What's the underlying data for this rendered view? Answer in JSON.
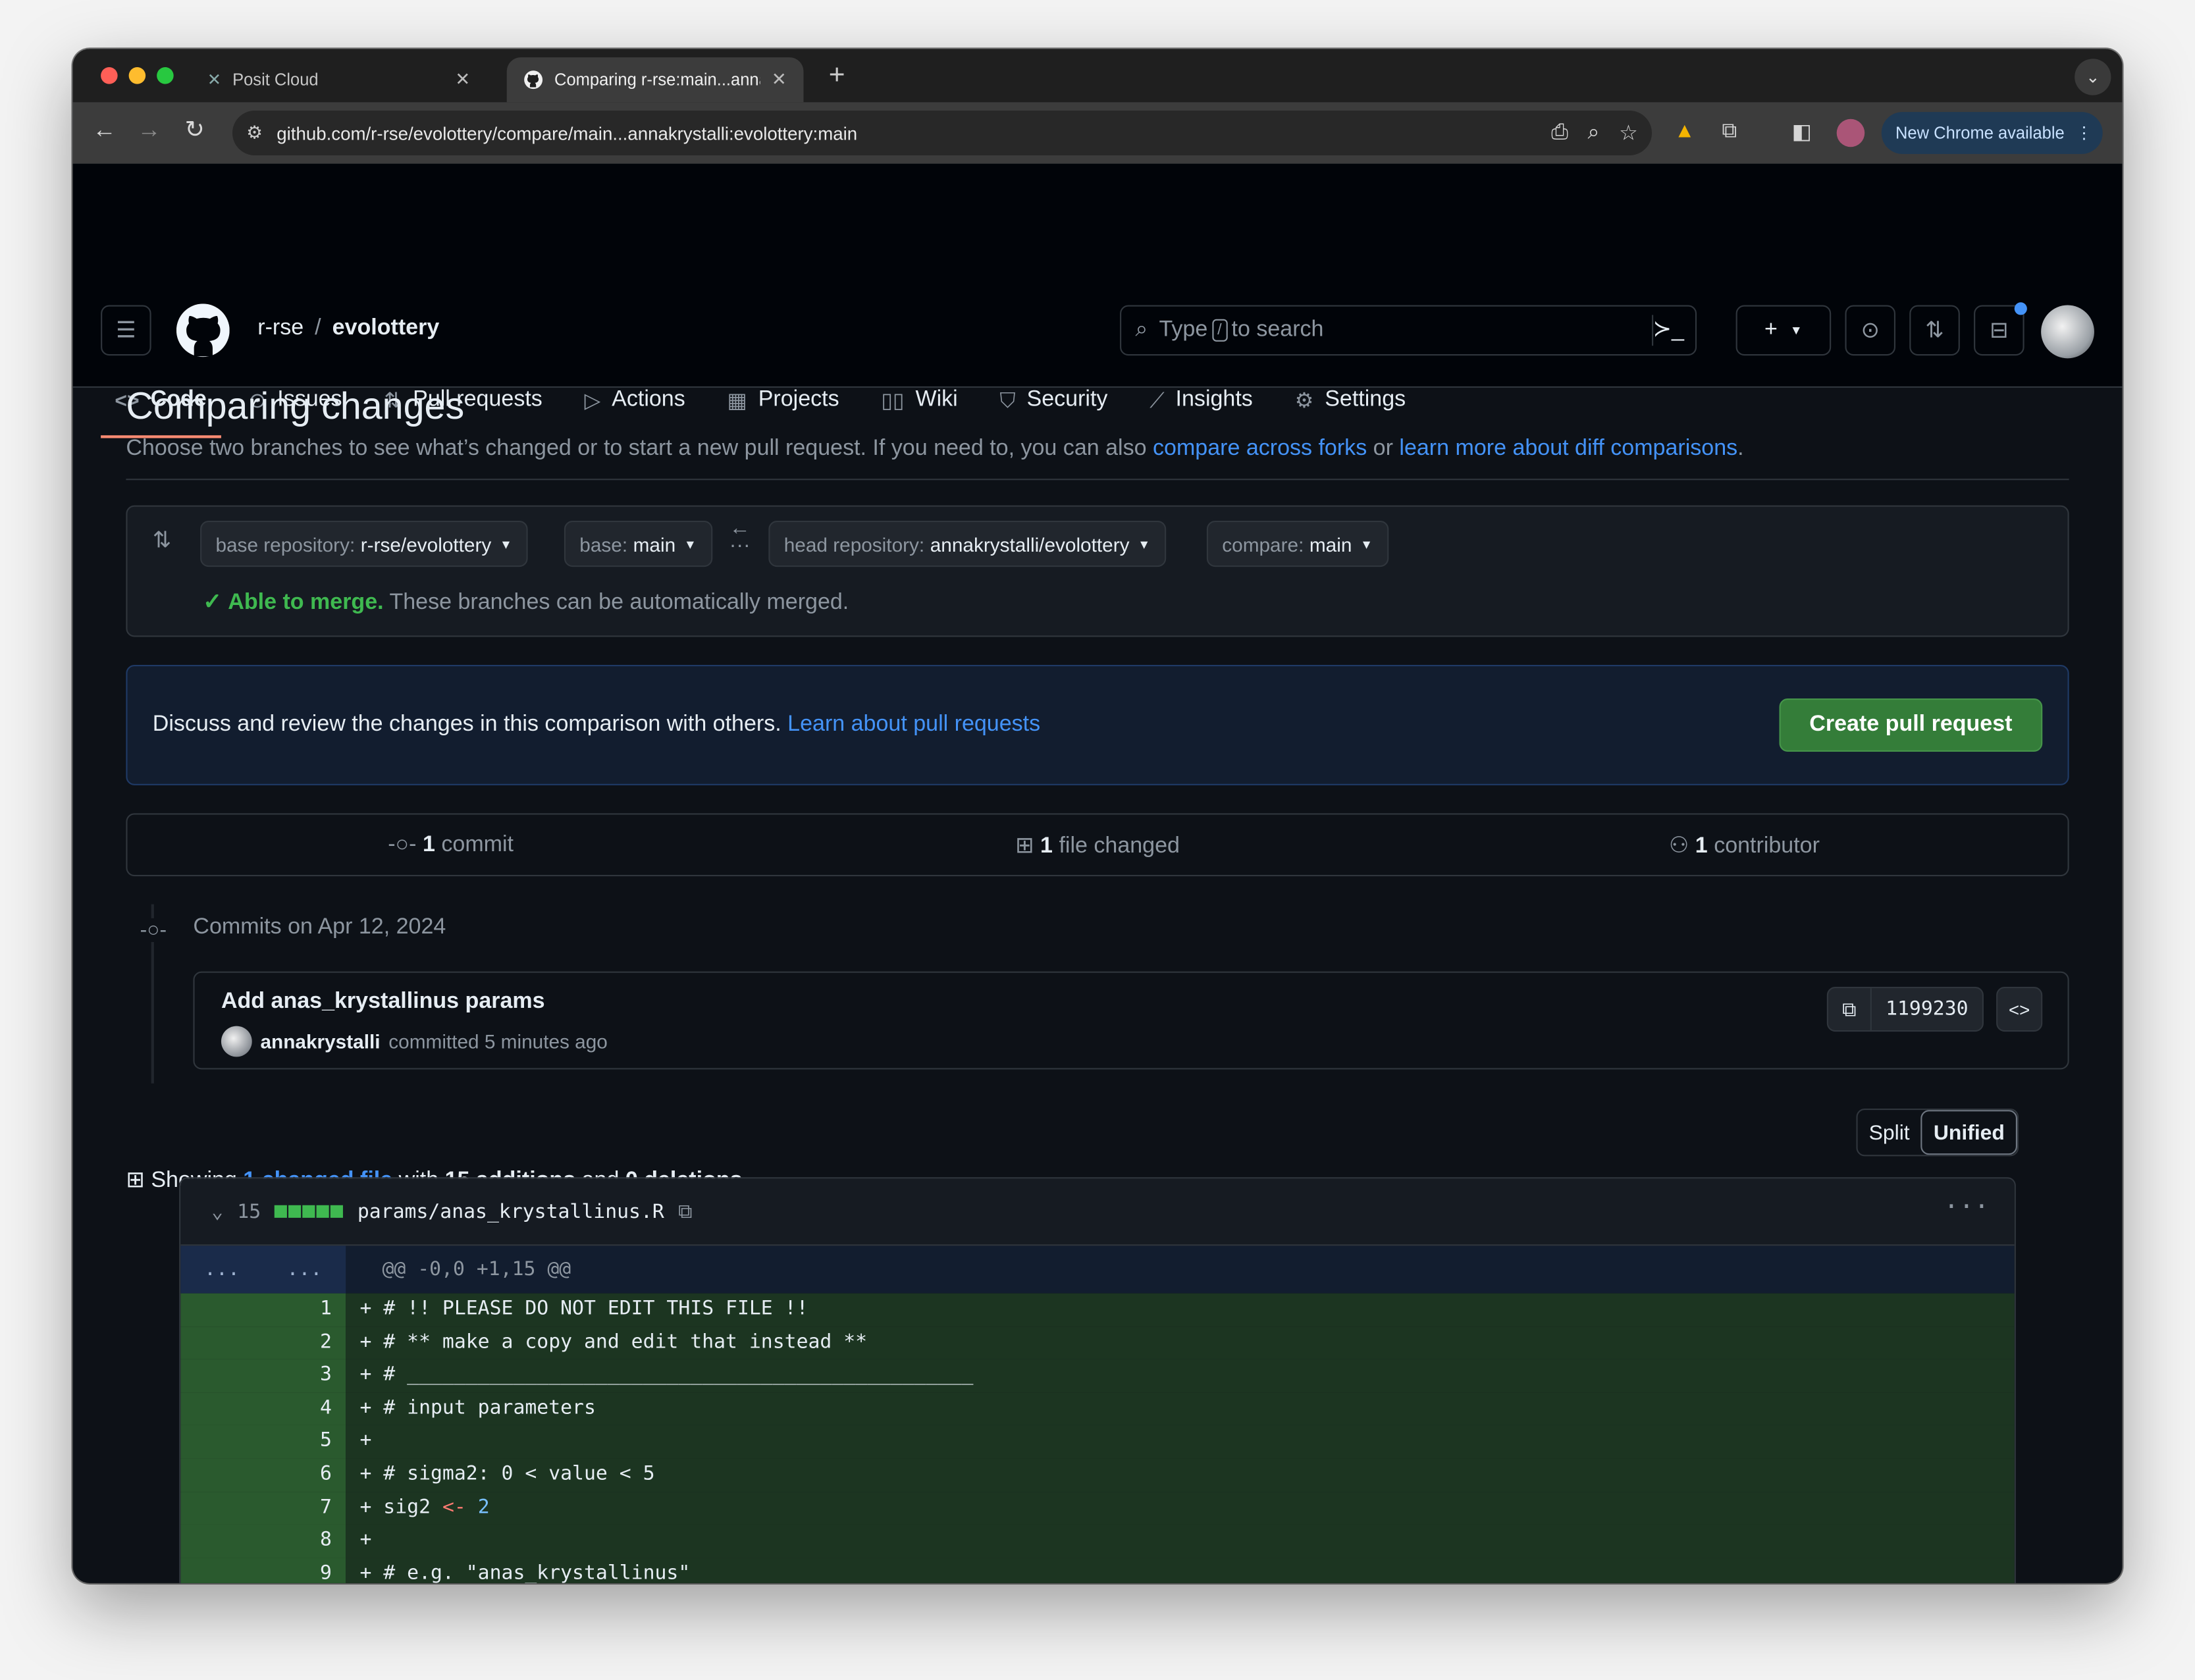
{
  "browser": {
    "tabs": [
      {
        "title": "Posit Cloud",
        "close": "✕"
      },
      {
        "title": "Comparing r-rse:main...annak",
        "close": "✕"
      }
    ],
    "new_tab": "+",
    "url": "github.com/r-rse/evolottery/compare/main...annakrystalli:evolottery:main",
    "update_label": "New Chrome available"
  },
  "header": {
    "owner": "r-rse",
    "separator": "/",
    "repo": "evolottery",
    "search_prefix": "Type",
    "search_key": "/",
    "search_suffix": "to search",
    "plus": "+"
  },
  "nav": {
    "items": [
      {
        "label": "Code",
        "icon": "code-icon",
        "glyph": "<>"
      },
      {
        "label": "Issues",
        "icon": "issue-icon",
        "glyph": "⊙"
      },
      {
        "label": "Pull requests",
        "icon": "pull-request-icon",
        "glyph": "⇅"
      },
      {
        "label": "Actions",
        "icon": "play-icon",
        "glyph": "▷"
      },
      {
        "label": "Projects",
        "icon": "table-icon",
        "glyph": "▦"
      },
      {
        "label": "Wiki",
        "icon": "book-icon",
        "glyph": "📖"
      },
      {
        "label": "Security",
        "icon": "shield-icon",
        "glyph": "⛉"
      },
      {
        "label": "Insights",
        "icon": "graph-icon",
        "glyph": "📈"
      },
      {
        "label": "Settings",
        "icon": "gear-icon",
        "glyph": "⚙"
      }
    ]
  },
  "page": {
    "title": "Comparing changes",
    "subtitle_text": "Choose two branches to see what’s changed or to start a new pull request. If you need to, you can also",
    "link_forks": "compare across forks",
    "subtitle_or": "or",
    "link_learn": "learn more about diff comparisons",
    "period": "."
  },
  "range": {
    "base_repo_label": "base repository:",
    "base_repo_value": "r-rse/evolottery",
    "base_label": "base:",
    "base_value": "main",
    "head_repo_label": "head repository:",
    "head_repo_value": "annakrystalli/evolottery",
    "compare_label": "compare:",
    "compare_value": "main",
    "merge_status": "Able to merge.",
    "merge_text": "These branches can be automatically merged."
  },
  "discuss": {
    "text": "Discuss and review the changes in this comparison with others.",
    "link": "Learn about pull requests",
    "button": "Create pull request"
  },
  "stats": {
    "commits_count": "1",
    "commits_label": "commit",
    "files_count": "1",
    "files_label": "file changed",
    "contributors_count": "1",
    "contributors_label": "contributor"
  },
  "commits": {
    "date": "Commits on Apr 12, 2024",
    "title": "Add anas_krystallinus params",
    "author": "annakrystalli",
    "meta": "committed 5 minutes ago",
    "sha": "1199230"
  },
  "summary": {
    "showing": "Showing",
    "changed_link": "1 changed file",
    "with": "with",
    "additions": "15 additions",
    "and": "and",
    "deletions": "0 deletions",
    "period": ".",
    "split": "Split",
    "unified": "Unified"
  },
  "diff": {
    "count": "15",
    "filename": "params/anas_krystallinus.R",
    "expand_left": "...",
    "expand_right": "...",
    "hunk": "@@ -0,0 +1,15 @@",
    "lines": [
      {
        "n": "1",
        "text": "+ # !! PLEASE DO NOT EDIT THIS FILE !!"
      },
      {
        "n": "2",
        "text": "+ # ** make a copy and edit that instead **"
      },
      {
        "n": "3",
        "text": "+ # ________________________________________________"
      },
      {
        "n": "4",
        "text": "+ # input parameters"
      },
      {
        "n": "5",
        "text": "+"
      },
      {
        "n": "6",
        "text": "+ # sigma2: 0 < value < 5"
      },
      {
        "n": "7",
        "pre": "+ sig2 ",
        "op": "<-",
        "num": " 2"
      },
      {
        "n": "8",
        "text": "+"
      },
      {
        "n": "9",
        "text": "+ # e.g. \"anas_krystallinus\""
      }
    ]
  }
}
